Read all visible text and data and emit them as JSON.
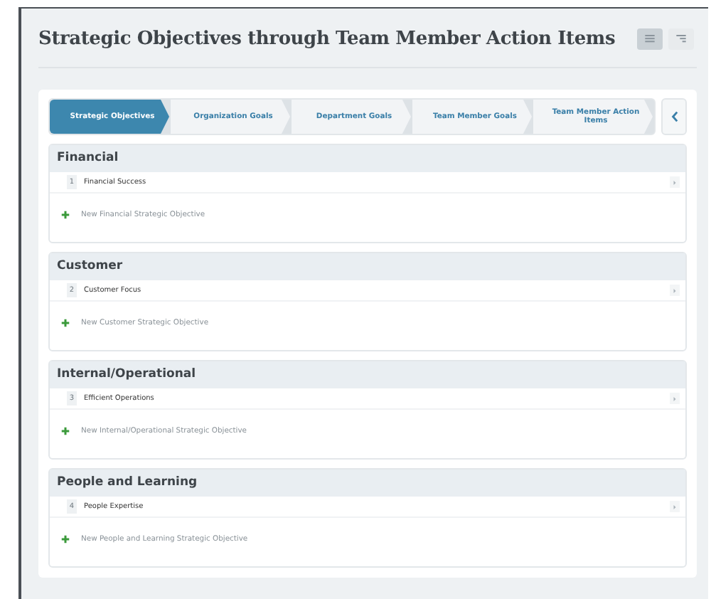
{
  "page": {
    "title": "Strategic Objectives through Team Member Action Items"
  },
  "view_toggles": [
    {
      "kind": "list",
      "selected": true
    },
    {
      "kind": "tree",
      "selected": false
    }
  ],
  "steps": [
    {
      "label": "Strategic Objectives",
      "selected": true
    },
    {
      "label": "Organization Goals",
      "selected": false
    },
    {
      "label": "Department Goals",
      "selected": false
    },
    {
      "label": "Team Member Goals",
      "selected": false
    },
    {
      "label": "Team Member Action Items",
      "selected": false
    }
  ],
  "sections": [
    {
      "title": "Financial",
      "items": [
        {
          "number": "1",
          "name": "Financial Success"
        }
      ],
      "add_label": "New Financial Strategic Objective"
    },
    {
      "title": "Customer",
      "items": [
        {
          "number": "2",
          "name": "Customer Focus"
        }
      ],
      "add_label": "New Customer Strategic Objective"
    },
    {
      "title": "Internal/Operational",
      "items": [
        {
          "number": "3",
          "name": "Efficient Operations"
        }
      ],
      "add_label": "New Internal/Operational Strategic Objective"
    },
    {
      "title": "People and Learning",
      "items": [
        {
          "number": "4",
          "name": "People Expertise"
        }
      ],
      "add_label": "New People and Learning Strategic Objective"
    }
  ]
}
